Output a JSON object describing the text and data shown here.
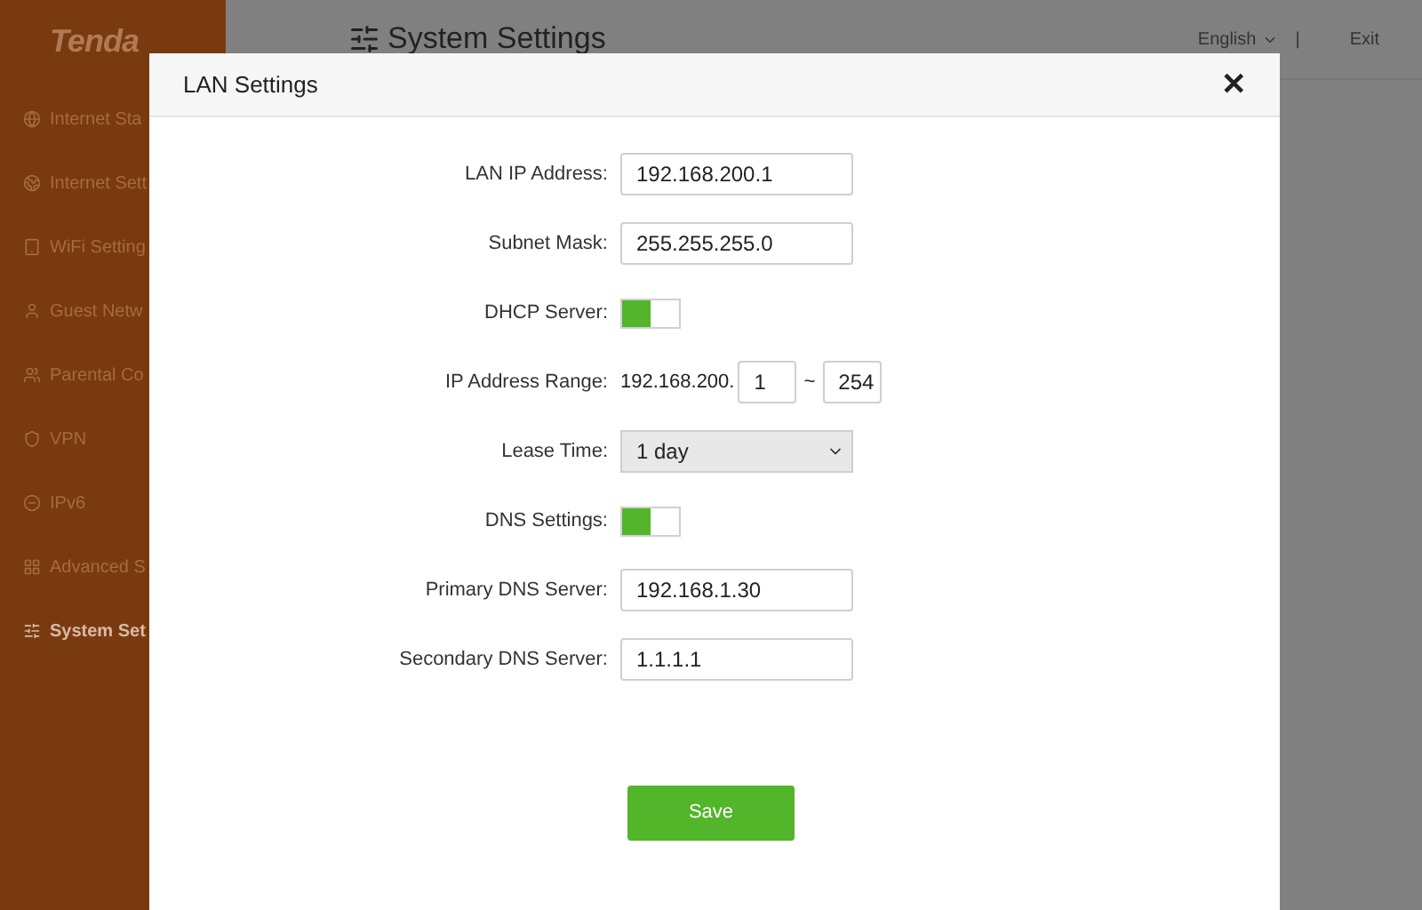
{
  "logo": "Tenda",
  "sidebar": {
    "items": [
      {
        "label": "Internet Sta",
        "selected": false
      },
      {
        "label": "Internet Sett",
        "selected": false
      },
      {
        "label": "WiFi Setting",
        "selected": false
      },
      {
        "label": "Guest Netw",
        "selected": false
      },
      {
        "label": "Parental Co",
        "selected": false
      },
      {
        "label": "VPN",
        "selected": false
      },
      {
        "label": "IPv6",
        "selected": false
      },
      {
        "label": "Advanced S",
        "selected": false
      },
      {
        "label": "System Set",
        "selected": true
      }
    ]
  },
  "header": {
    "title": "System Settings",
    "language": "English",
    "separator": "|",
    "exit": "Exit"
  },
  "dialog": {
    "title": "LAN Settings",
    "close": "✕",
    "fields": [
      {
        "kind": "text",
        "label": "LAN IP Address:",
        "value": "192.168.200.1"
      },
      {
        "kind": "text",
        "label": "Subnet Mask:",
        "value": "255.255.255.0"
      },
      {
        "kind": "toggle",
        "label": "DHCP Server:",
        "on": true
      },
      {
        "kind": "range",
        "label": "IP Address Range:",
        "prefix": "192.168.200.",
        "start": "1",
        "tilde": "~",
        "end": "254"
      },
      {
        "kind": "select",
        "label": "Lease Time:",
        "value": "1 day"
      },
      {
        "kind": "toggle",
        "label": "DNS Settings:",
        "on": true
      },
      {
        "kind": "text",
        "label": "Primary DNS Server:",
        "value": "192.168.1.30"
      },
      {
        "kind": "text",
        "label": "Secondary DNS Server:",
        "value": "1.1.1.1"
      }
    ],
    "save": "Save"
  }
}
